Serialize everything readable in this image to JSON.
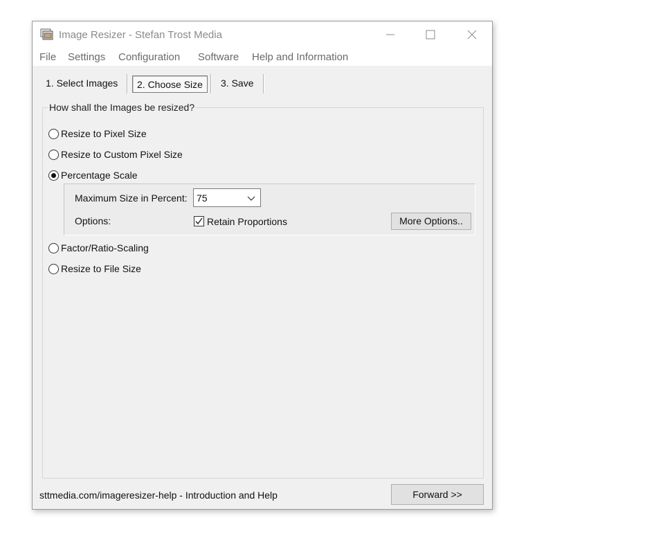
{
  "window": {
    "title": "Image Resizer - Stefan Trost Media",
    "icon": "app-window-icon",
    "controls": {
      "minimize": "minimize-icon",
      "maximize": "maximize-icon",
      "close": "close-icon"
    }
  },
  "menu": [
    "File",
    "Settings",
    "Configuration",
    "Software",
    "Help and Information"
  ],
  "tabs": [
    {
      "label": "1. Select Images",
      "active": false
    },
    {
      "label": "2. Choose Size",
      "active": true
    },
    {
      "label": "3. Save",
      "active": false
    }
  ],
  "group": {
    "title": "How shall the Images be resized?",
    "options": [
      {
        "label": "Resize to Pixel Size",
        "checked": false
      },
      {
        "label": "Resize to Custom Pixel Size",
        "checked": false
      },
      {
        "label": "Percentage Scale",
        "checked": true
      },
      {
        "label": "Factor/Ratio-Scaling",
        "checked": false
      },
      {
        "label": "Resize to File Size",
        "checked": false
      }
    ],
    "percentage": {
      "max_size_label": "Maximum Size in Percent:",
      "max_size_value": "75",
      "options_label": "Options:",
      "retain_proportions_label": "Retain Proportions",
      "retain_proportions_checked": true,
      "more_options_label": "More Options.."
    }
  },
  "footer": {
    "help_link": "sttmedia.com/imageresizer-help - Introduction and Help",
    "forward_label": "Forward >>"
  }
}
